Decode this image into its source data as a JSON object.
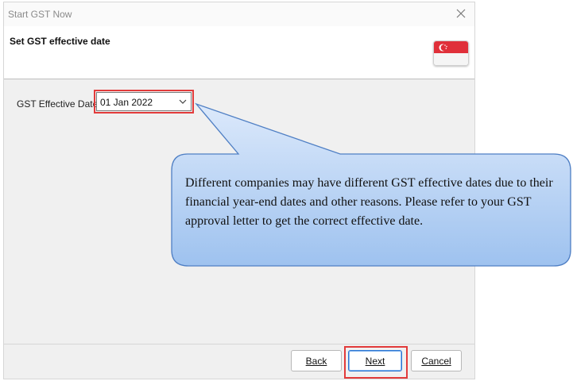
{
  "window": {
    "title": "Start GST Now"
  },
  "header": {
    "title": "Set GST effective date"
  },
  "form": {
    "effective_date_label": "GST Effective Date",
    "effective_date_value": "01 Jan 2022"
  },
  "callout": {
    "text": "Different companies may have different GST effective dates due to their financial year-end dates and other reasons. Please refer to your GST approval letter to get the correct effective date."
  },
  "buttons": {
    "back_label": "Back",
    "next_label": "Next",
    "cancel_label": "Cancel"
  },
  "icons": {
    "close": "close-icon",
    "flag": "singapore-flag-icon",
    "dropdown": "chevron-down-icon"
  },
  "colors": {
    "highlight": "#e23b3b",
    "callout_fill_top": "#dce9fb",
    "callout_fill_bottom": "#9ec2ef",
    "callout_border": "#4f7fc4",
    "flag_red": "#e0303a"
  }
}
